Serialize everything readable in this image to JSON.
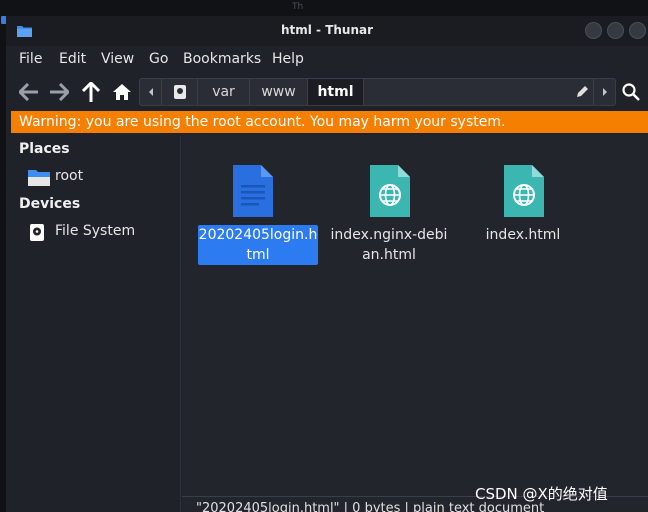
{
  "window": {
    "title": "html - Thunar"
  },
  "menubar": {
    "items": [
      "File",
      "Edit",
      "View",
      "Go",
      "Bookmarks",
      "Help"
    ]
  },
  "toolbar": {
    "back_icon": "arrow-left-icon",
    "forward_icon": "arrow-right-icon",
    "up_icon": "arrow-up-icon",
    "home_icon": "home-icon",
    "breadcrumbs": [
      "var",
      "www",
      "html"
    ],
    "active_crumb": "html"
  },
  "warning": {
    "text": "Warning: you are using the root account. You may harm your system.",
    "color": "#f57f00"
  },
  "sidebar": {
    "places_heading": "Places",
    "places": [
      {
        "label": "root",
        "icon": "folder-icon"
      }
    ],
    "devices_heading": "Devices",
    "devices": [
      {
        "label": "File System",
        "icon": "drive-icon"
      }
    ]
  },
  "files": [
    {
      "name": "20202405login.html",
      "icon": "text-document-icon",
      "selected": true
    },
    {
      "name": "index.nginx-debian.html",
      "icon": "web-document-icon",
      "selected": false
    },
    {
      "name": "index.html",
      "icon": "web-document-icon",
      "selected": false
    }
  ],
  "statusbar": {
    "text": "\"20202405login.html\" | 0 bytes | plain text document"
  },
  "watermark": {
    "text": "CSDN @X的绝对值"
  },
  "colors": {
    "accent": "#2d7bf0",
    "warning": "#f57f00",
    "web_icon": "#3bb6b1"
  }
}
